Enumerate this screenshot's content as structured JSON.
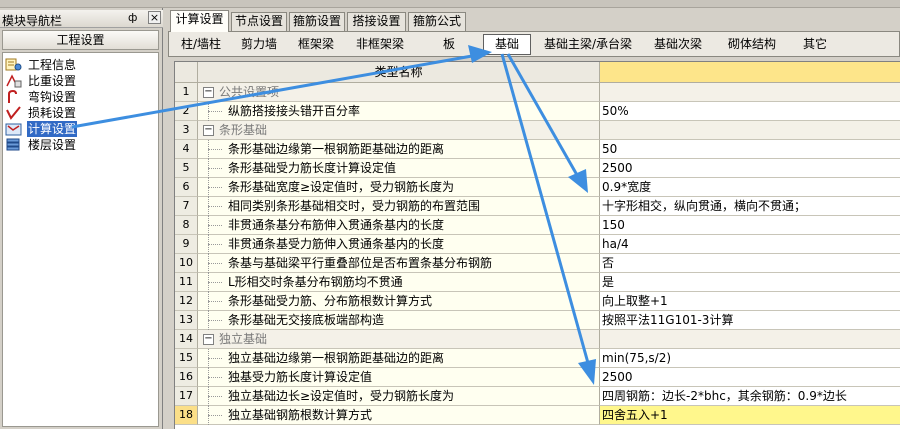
{
  "nav": {
    "title": "模块导航栏",
    "pin_glyph": "ф",
    "close_glyph": "×",
    "section": "工程设置",
    "items": [
      {
        "label": "工程信息",
        "icon": "project-info-icon"
      },
      {
        "label": "比重设置",
        "icon": "ratio-icon"
      },
      {
        "label": "弯钩设置",
        "icon": "hook-icon"
      },
      {
        "label": "损耗设置",
        "icon": "loss-icon"
      },
      {
        "label": "计算设置",
        "icon": "calc-icon"
      },
      {
        "label": "楼层设置",
        "icon": "floor-icon"
      }
    ]
  },
  "tabs": [
    "计算设置",
    "节点设置",
    "箍筋设置",
    "搭接设置",
    "箍筋公式"
  ],
  "subtabs": [
    "柱/墙柱",
    "剪力墙",
    "框架梁",
    "非框架梁",
    "板",
    "基础",
    "基础主梁/承台梁",
    "基础次梁",
    "砌体结构",
    "其它"
  ],
  "grid": {
    "header_name": "类型名称",
    "rows": [
      {
        "num": "1",
        "name": "公共设置项",
        "value": "",
        "group": true
      },
      {
        "num": "2",
        "name": "纵筋搭接接头错开百分率",
        "value": "50%"
      },
      {
        "num": "3",
        "name": "条形基础",
        "value": "",
        "group": true
      },
      {
        "num": "4",
        "name": "条形基础边缘第一根钢筋距基础边的距离",
        "value": "50"
      },
      {
        "num": "5",
        "name": "条形基础受力筋长度计算设定值",
        "value": "2500"
      },
      {
        "num": "6",
        "name": "条形基础宽度≥设定值时，受力钢筋长度为",
        "value": "0.9*宽度"
      },
      {
        "num": "7",
        "name": "相同类别条形基础相交时，受力钢筋的布置范围",
        "value": "十字形相交，纵向贯通，横向不贯通；"
      },
      {
        "num": "8",
        "name": "非贯通条基分布筋伸入贯通条基内的长度",
        "value": "150"
      },
      {
        "num": "9",
        "name": "非贯通条基受力筋伸入贯通条基内的长度",
        "value": "ha/4"
      },
      {
        "num": "10",
        "name": "条基与基础梁平行重叠部位是否布置条基分布钢筋",
        "value": "否"
      },
      {
        "num": "11",
        "name": "L形相交时条基分布钢筋均不贯通",
        "value": "是"
      },
      {
        "num": "12",
        "name": "条形基础受力筋、分布筋根数计算方式",
        "value": "向上取整+1"
      },
      {
        "num": "13",
        "name": "条形基础无交接底板端部构造",
        "value": "按照平法11G101-3计算"
      },
      {
        "num": "14",
        "name": "独立基础",
        "value": "",
        "group": true
      },
      {
        "num": "15",
        "name": "独立基础边缘第一根钢筋距基础边的距离",
        "value": "min(75,s/2)"
      },
      {
        "num": "16",
        "name": "独基受力筋长度计算设定值",
        "value": "2500"
      },
      {
        "num": "17",
        "name": "独立基础边长≥设定值时，受力钢筋长度为",
        "value": "四周钢筋：边长-2*bhc，其余钢筋：0.9*边长"
      },
      {
        "num": "18",
        "name": "独立基础钢筋根数计算方式",
        "value": "四舍五入+1",
        "current": true
      }
    ]
  },
  "colors": {
    "accent": "#3d8ee0",
    "selection": "#316ac5",
    "current_cell": "#fff78c"
  }
}
